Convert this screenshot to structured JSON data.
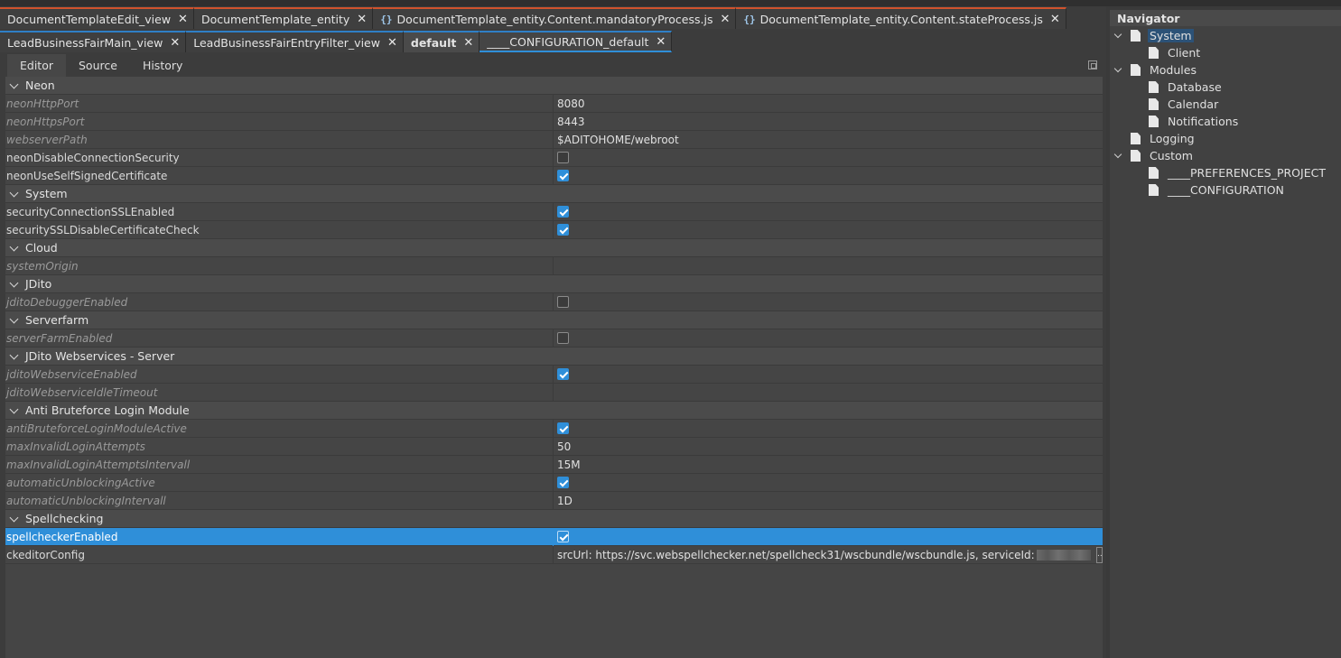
{
  "editor_tabs_row1": [
    {
      "label": "DocumentTemplateEdit_view",
      "js": false
    },
    {
      "label": "DocumentTemplate_entity",
      "js": false
    },
    {
      "label": "DocumentTemplate_entity.Content.mandatoryProcess.js",
      "js": true
    },
    {
      "label": "DocumentTemplate_entity.Content.stateProcess.js",
      "js": true
    }
  ],
  "editor_tabs_row2": [
    {
      "label": "LeadBusinessFairMain_view",
      "active": false
    },
    {
      "label": "LeadBusinessFairEntryFilter_view",
      "active": false
    },
    {
      "label": "default",
      "active": true
    },
    {
      "label": "____CONFIGURATION_default",
      "active": false
    }
  ],
  "js_icon": "{}",
  "close_glyph": "✕",
  "subtabs": [
    "Editor",
    "Source",
    "History"
  ],
  "properties": [
    {
      "group": "Neon"
    },
    {
      "key": "neonHttpPort",
      "italic": true,
      "value": "8080"
    },
    {
      "key": "neonHttpsPort",
      "italic": true,
      "value": "8443"
    },
    {
      "key": "webserverPath",
      "italic": true,
      "value": "$ADITOHOME/webroot"
    },
    {
      "key": "neonDisableConnectionSecurity",
      "italic": false,
      "checkbox": false
    },
    {
      "key": "neonUseSelfSignedCertificate",
      "italic": false,
      "checkbox": true
    },
    {
      "group": "System"
    },
    {
      "key": "securityConnectionSSLEnabled",
      "italic": false,
      "checkbox": true
    },
    {
      "key": "securitySSLDisableCertificateCheck",
      "italic": false,
      "checkbox": true
    },
    {
      "group": "Cloud"
    },
    {
      "key": "systemOrigin",
      "italic": true,
      "value": ""
    },
    {
      "group": "JDito"
    },
    {
      "key": "jditoDebuggerEnabled",
      "italic": true,
      "checkbox": false
    },
    {
      "group": "Serverfarm"
    },
    {
      "key": "serverFarmEnabled",
      "italic": true,
      "checkbox": false
    },
    {
      "group": "JDito Webservices - Server"
    },
    {
      "key": "jditoWebserviceEnabled",
      "italic": true,
      "checkbox": true
    },
    {
      "key": "jditoWebserviceIdleTimeout",
      "italic": true,
      "value": ""
    },
    {
      "group": "Anti Bruteforce Login Module"
    },
    {
      "key": "antiBruteforceLoginModuleActive",
      "italic": true,
      "checkbox": true
    },
    {
      "key": "maxInvalidLoginAttempts",
      "italic": true,
      "value": "50"
    },
    {
      "key": "maxInvalidLoginAttemptsIntervall",
      "italic": true,
      "value": "15M"
    },
    {
      "key": "automaticUnblockingActive",
      "italic": true,
      "checkbox": true
    },
    {
      "key": "automaticUnblockingIntervall",
      "italic": true,
      "value": "1D"
    },
    {
      "group": "Spellchecking"
    },
    {
      "key": "spellcheckerEnabled",
      "italic": false,
      "checkbox": true,
      "selected": true
    },
    {
      "key": "ckeditorConfig",
      "italic": false,
      "value": "srcUrl: https://svc.webspellchecker.net/spellcheck31/wscbundle/wscbundle.js, serviceId:",
      "redacted": true,
      "ellipsis": "..."
    }
  ],
  "navigator": {
    "title": "Navigator",
    "tree": [
      {
        "label": "System",
        "level": 0,
        "expandable": true,
        "selected": true
      },
      {
        "label": "Client",
        "level": 1,
        "expandable": false
      },
      {
        "label": "Modules",
        "level": 0,
        "expandable": true
      },
      {
        "label": "Database",
        "level": 1,
        "expandable": false
      },
      {
        "label": "Calendar",
        "level": 1,
        "expandable": false
      },
      {
        "label": "Notifications",
        "level": 1,
        "expandable": false
      },
      {
        "label": "Logging",
        "level": 0,
        "expandable": false
      },
      {
        "label": "Custom",
        "level": 0,
        "expandable": true
      },
      {
        "label": "____PREFERENCES_PROJECT",
        "level": 1,
        "expandable": false
      },
      {
        "label": "____CONFIGURATION",
        "level": 1,
        "expandable": false
      }
    ]
  },
  "colors": {
    "accent": "#2f8fd9",
    "tab_red": "#d0532d",
    "tab_blue": "#2f7fc6",
    "bg": "#3c3c3c"
  }
}
